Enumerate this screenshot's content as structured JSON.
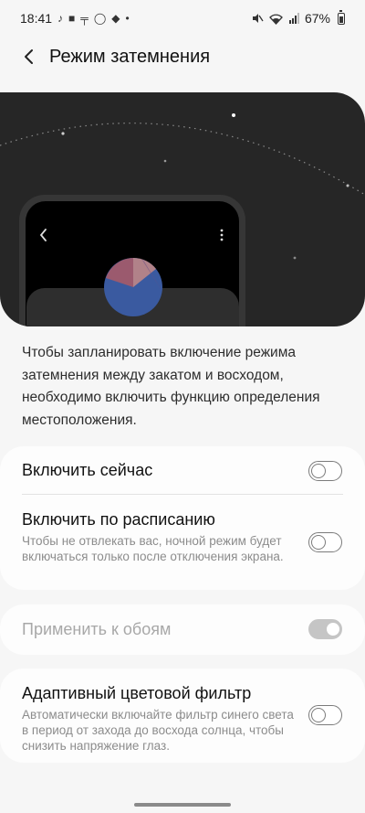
{
  "status_bar": {
    "time": "18:41",
    "left_icons": [
      "tiktok-icon",
      "message-icon",
      "pin-icon",
      "circle-icon",
      "bag-icon",
      "dot-icon"
    ],
    "battery_percent": "67%",
    "right_icons": [
      "mute-icon",
      "wifi-icon",
      "signal-icon",
      "battery-icon"
    ]
  },
  "header": {
    "title": "Режим затемнения",
    "back_icon": "chevron-left-icon"
  },
  "description": "Чтобы запланировать включение режима затемнения между закатом и восходом, необходимо включить функцию определения местоположения.",
  "settings": {
    "turn_on_now": {
      "title": "Включить сейчас",
      "enabled": false
    },
    "scheduled": {
      "title": "Включить по расписанию",
      "subtitle": "Чтобы не отвлекать вас, ночной режим будет включаться только после отключения экрана.",
      "enabled": false
    },
    "apply_wallpaper": {
      "title": "Применить к обоям",
      "enabled": true,
      "disabled": true
    },
    "adaptive_filter": {
      "title": "Адаптивный цветовой фильтр",
      "subtitle": "Автоматически включайте фильтр синего света в период от захода до восхода солнца, чтобы снизить напряжение глаз.",
      "enabled": false
    }
  },
  "colors": {
    "illustration_bg": "#262626",
    "moon": "#f5c211",
    "toggle_outline": "#7b7b7b"
  }
}
